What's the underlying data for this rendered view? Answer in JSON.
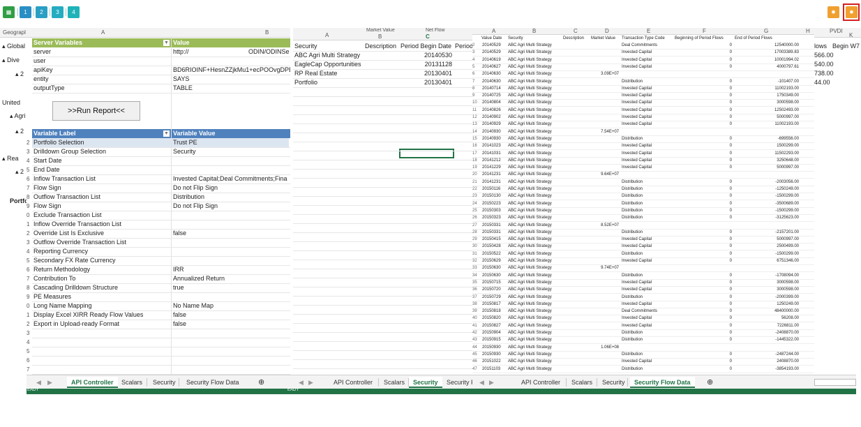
{
  "toolbar": {
    "left_buttons": [
      "1",
      "2",
      "3",
      "4"
    ],
    "accent": "#21a0b4",
    "highlight": "#e02020",
    "orange": "#f0a030"
  },
  "left_strip": {
    "col_header": "Geograpl",
    "labels": [
      "▴ Global",
      "▴ Dive",
      "▴ 2",
      "United",
      "▴ Agri",
      "▴ 2",
      "▴ Rea",
      "▴ 2",
      "Portfo"
    ]
  },
  "api": {
    "col_a": "A",
    "col_b": "B",
    "server_header": "Server Variables",
    "value_header": "Value",
    "server_rows": [
      {
        "name": "server",
        "value": "http://",
        "extra": "ODIN/ODINSe"
      },
      {
        "name": "user",
        "value": "",
        "extra": ""
      },
      {
        "name": "apiKey",
        "value": "BD6RIOINF+HesnZZjkMu1+ecPOOvgDPB+",
        "extra": ""
      },
      {
        "name": "entity",
        "value": "SAYS",
        "extra": ""
      },
      {
        "name": "outputType",
        "value": "TABLE",
        "extra": ""
      }
    ],
    "run_button": ">>Run Report<<",
    "var_label_header": "Variable Label",
    "var_value_header": "Variable Value",
    "vars": [
      {
        "num": "2",
        "label": "Portfolio Selection",
        "value": "Trust PE"
      },
      {
        "num": "3",
        "label": "Drilldown Group Selection",
        "value": "Security"
      },
      {
        "num": "4",
        "label": "Start Date",
        "value": ""
      },
      {
        "num": "5",
        "label": "End Date",
        "value": ""
      },
      {
        "num": "6",
        "label": "Inflow Transaction List",
        "value": "Invested Capital;Deal Commitments;Fina"
      },
      {
        "num": "7",
        "label": "Flow Sign",
        "value": "Do not Flip Sign"
      },
      {
        "num": "8",
        "label": "Outflow Transaction List",
        "value": "Distribution"
      },
      {
        "num": "9",
        "label": "Flow Sign",
        "value": "Do not Flip Sign"
      },
      {
        "num": "0",
        "label": "Exclude Transaction List",
        "value": ""
      },
      {
        "num": "1",
        "label": "Inflow Override Transaction List",
        "value": ""
      },
      {
        "num": "2",
        "label": "Override List Is Exclusive",
        "value": "false"
      },
      {
        "num": "3",
        "label": "Outflow Override Transaction List",
        "value": ""
      },
      {
        "num": "4",
        "label": "Reporting Currency",
        "value": ""
      },
      {
        "num": "5",
        "label": "Secondary FX Rate Currency",
        "value": ""
      },
      {
        "num": "6",
        "label": "Return Methodology",
        "value": "IRR"
      },
      {
        "num": "7",
        "label": "Contribution To",
        "value": "Annualized Return"
      },
      {
        "num": "8",
        "label": "Cascading Drilldown Structure",
        "value": "true"
      },
      {
        "num": "9",
        "label": "PE Measures",
        "value": ""
      },
      {
        "num": "0",
        "label": "Long Name Mapping",
        "value": "No Name Map"
      },
      {
        "num": "1",
        "label": "Display Excel XIRR Ready Flow Values",
        "value": "false"
      },
      {
        "num": "2",
        "label": "Export in Upload-ready Format",
        "value": "false"
      },
      {
        "num": "3",
        "label": "",
        "value": ""
      },
      {
        "num": "4",
        "label": "",
        "value": ""
      },
      {
        "num": "5",
        "label": "",
        "value": ""
      },
      {
        "num": "6",
        "label": "",
        "value": ""
      },
      {
        "num": "7",
        "label": "",
        "value": ""
      }
    ],
    "tabs": [
      "API Controller",
      "Scalars",
      "Security",
      "Security Flow Data"
    ],
    "active_tab": "API Controller",
    "status": "EADY"
  },
  "security": {
    "col_headers": [
      "A",
      "B",
      "C"
    ],
    "top_headers": [
      "Market Value",
      "Net Flow"
    ],
    "headers": [
      "Security",
      "Description",
      "Period Begin Date",
      "Period"
    ],
    "rows": [
      {
        "name": "ABC Agri Multi Strategy",
        "date": "20140530"
      },
      {
        "name": "EagleCap Opportunities",
        "date": "20131128"
      },
      {
        "name": "RP Real Estate",
        "date": "20130401"
      },
      {
        "name": "Portfolio",
        "date": "20130401"
      }
    ],
    "tabs": [
      "API Controller",
      "Scalars",
      "Security",
      "Security Fl"
    ],
    "active_tab": "Security",
    "status": "EADY"
  },
  "flow": {
    "col_headers": [
      "A",
      "B",
      "C",
      "D",
      "E",
      "F",
      "G",
      "H"
    ],
    "headers": [
      "Value Date",
      "Security",
      "Description",
      "Market Value",
      "Transaction Type Code",
      "Beginning of Period Flows",
      "End of Period Flows"
    ],
    "rows": [
      [
        "2",
        "20140529",
        "ABC Agri Multi Strategy",
        "",
        "Deal Commitments",
        "0",
        "12540000.00"
      ],
      [
        "3",
        "20140529",
        "ABC Agri Multi Strategy",
        "",
        "Invested Capital",
        "0",
        "17003389.83"
      ],
      [
        "4",
        "20140619",
        "ABC Agri Multi Strategy",
        "",
        "Invested Capital",
        "0",
        "10001994.02"
      ],
      [
        "5",
        "20140627",
        "ABC Agri Multi Strategy",
        "",
        "Invested Capital",
        "0",
        "4000797.61"
      ],
      [
        "6",
        "20140630",
        "ABC Agri Multi Strategy",
        "3.09E+07",
        "",
        "",
        ""
      ],
      [
        "7",
        "20140630",
        "ABC Agri Multi Strategy",
        "",
        "Distribution",
        "0",
        "-101407.00"
      ],
      [
        "8",
        "20140714",
        "ABC Agri Multi Strategy",
        "",
        "Invested Capital",
        "0",
        "11002193.00"
      ],
      [
        "9",
        "20140725",
        "ABC Agri Multi Strategy",
        "",
        "Invested Capital",
        "0",
        "1750349.00"
      ],
      [
        "10",
        "20140804",
        "ABC Agri Multi Strategy",
        "",
        "Invested Capital",
        "0",
        "3000598.00"
      ],
      [
        "11",
        "20140826",
        "ABC Agri Multi Strategy",
        "",
        "Invested Capital",
        "0",
        "12502493.00"
      ],
      [
        "12",
        "20140902",
        "ABC Agri Multi Strategy",
        "",
        "Invested Capital",
        "0",
        "5000997.00"
      ],
      [
        "13",
        "20140929",
        "ABC Agri Multi Strategy",
        "",
        "Invested Capital",
        "0",
        "11002193.00"
      ],
      [
        "14",
        "20140930",
        "ABC Agri Multi Strategy",
        "7.54E+07",
        "",
        "",
        ""
      ],
      [
        "15",
        "20140930",
        "ABC Agri Multi Strategy",
        "",
        "Distribution",
        "0",
        "-699556.00"
      ],
      [
        "16",
        "20141023",
        "ABC Agri Multi Strategy",
        "",
        "Invested Capital",
        "0",
        "1500299.00"
      ],
      [
        "17",
        "20141031",
        "ABC Agri Multi Strategy",
        "",
        "Invested Capital",
        "0",
        "11502293.00"
      ],
      [
        "18",
        "20141212",
        "ABC Agri Multi Strategy",
        "",
        "Invested Capital",
        "0",
        "3250648.00"
      ],
      [
        "19",
        "20141229",
        "ABC Agri Multi Strategy",
        "",
        "Invested Capital",
        "0",
        "5000997.00"
      ],
      [
        "20",
        "20141231",
        "ABC Agri Multi Strategy",
        "9.64E+07",
        "",
        "",
        ""
      ],
      [
        "21",
        "20141231",
        "ABC Agri Multi Strategy",
        "",
        "Distribution",
        "0",
        "-2003056.00"
      ],
      [
        "22",
        "20150116",
        "ABC Agri Multi Strategy",
        "",
        "Distribution",
        "0",
        "-1250249.00"
      ],
      [
        "23",
        "20150130",
        "ABC Agri Multi Strategy",
        "",
        "Distribution",
        "0",
        "-1500299.00"
      ],
      [
        "24",
        "20150223",
        "ABC Agri Multi Strategy",
        "",
        "Distribution",
        "0",
        "-3500689.00"
      ],
      [
        "25",
        "20150303",
        "ABC Agri Multi Strategy",
        "",
        "Distribution",
        "0",
        "-1500299.00"
      ],
      [
        "26",
        "20150323",
        "ABC Agri Multi Strategy",
        "",
        "Distribution",
        "0",
        "-3125623.00"
      ],
      [
        "27",
        "20150331",
        "ABC Agri Multi Strategy",
        "8.52E+07",
        "",
        "",
        ""
      ],
      [
        "28",
        "20150331",
        "ABC Agri Multi Strategy",
        "",
        "Distribution",
        "0",
        "-2157201.00"
      ],
      [
        "29",
        "20150415",
        "ABC Agri Multi Strategy",
        "",
        "Invested Capital",
        "0",
        "5000997.00"
      ],
      [
        "30",
        "20150428",
        "ABC Agri Multi Strategy",
        "",
        "Invested Capital",
        "0",
        "2500499.00"
      ],
      [
        "31",
        "20150522",
        "ABC Agri Multi Strategy",
        "",
        "Distribution",
        "0",
        "-1500299.00"
      ],
      [
        "32",
        "20150629",
        "ABC Agri Multi Strategy",
        "",
        "Invested Capital",
        "0",
        "6751346.00"
      ],
      [
        "33",
        "20150630",
        "ABC Agri Multi Strategy",
        "9.74E+07",
        "",
        "",
        ""
      ],
      [
        "34",
        "20150630",
        "ABC Agri Multi Strategy",
        "",
        "Distribution",
        "0",
        "-1708094.00"
      ],
      [
        "35",
        "20150715",
        "ABC Agri Multi Strategy",
        "",
        "Invested Capital",
        "0",
        "3000598.00"
      ],
      [
        "36",
        "20150720",
        "ABC Agri Multi Strategy",
        "",
        "Invested Capital",
        "0",
        "3000598.00"
      ],
      [
        "37",
        "20150729",
        "ABC Agri Multi Strategy",
        "",
        "Distribution",
        "0",
        "-2000399.00"
      ],
      [
        "38",
        "20150817",
        "ABC Agri Multi Strategy",
        "",
        "Invested Capital",
        "0",
        "1250249.00"
      ],
      [
        "39",
        "20150818",
        "ABC Agri Multi Strategy",
        "",
        "Deal Commitments",
        "0",
        "48400000.00"
      ],
      [
        "40",
        "20150820",
        "ABC Agri Multi Strategy",
        "",
        "Invested Capital",
        "0",
        "56208.00"
      ],
      [
        "41",
        "20150827",
        "ABC Agri Multi Strategy",
        "",
        "Invested Capital",
        "0",
        "7226811.00"
      ],
      [
        "42",
        "20150904",
        "ABC Agri Multi Strategy",
        "",
        "Distribution",
        "0",
        "-2408870.00"
      ],
      [
        "43",
        "20150915",
        "ABC Agri Multi Strategy",
        "",
        "Distribution",
        "0",
        "-1445322.00"
      ],
      [
        "44",
        "20150930",
        "ABC Agri Multi Strategy",
        "1.06E+08",
        "",
        "",
        ""
      ],
      [
        "45",
        "20150930",
        "ABC Agri Multi Strategy",
        "",
        "Distribution",
        "0",
        "-2487244.00"
      ],
      [
        "46",
        "20151022",
        "ABC Agri Multi Strategy",
        "",
        "Invested Capital",
        "0",
        "2408870.00"
      ],
      [
        "47",
        "20151103",
        "ABC Agri Multi Strategy",
        "",
        "Distribution",
        "0",
        "-3854193.00"
      ]
    ],
    "tabs": [
      "API Controller",
      "Scalars",
      "Security",
      "Security Flow Data"
    ],
    "active_tab": "Security Flow Data"
  },
  "right_strip": {
    "col_header": "PVDI",
    "col_letter": "K",
    "headers": [
      "lows",
      "Begin W7"
    ],
    "values": [
      "566.00",
      "540.00",
      "738.00",
      "44.00"
    ]
  }
}
